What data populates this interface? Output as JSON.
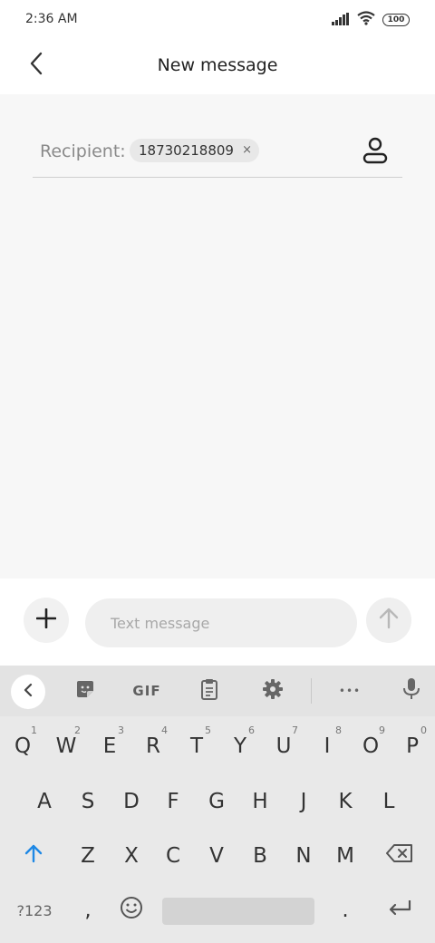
{
  "status": {
    "time": "2:36 AM",
    "battery": "100"
  },
  "header": {
    "title": "New message"
  },
  "recipient": {
    "label": "Recipient:",
    "number": "18730218809",
    "remove_symbol": "×"
  },
  "compose": {
    "placeholder": "Text message"
  },
  "keyboard": {
    "toolbar": {
      "gif_label": "GIF",
      "more_label": "•••"
    },
    "row1": [
      {
        "key": "Q",
        "hint": "1"
      },
      {
        "key": "W",
        "hint": "2"
      },
      {
        "key": "E",
        "hint": "3"
      },
      {
        "key": "R",
        "hint": "4"
      },
      {
        "key": "T",
        "hint": "5"
      },
      {
        "key": "Y",
        "hint": "6"
      },
      {
        "key": "U",
        "hint": "7"
      },
      {
        "key": "I",
        "hint": "8"
      },
      {
        "key": "O",
        "hint": "9"
      },
      {
        "key": "P",
        "hint": "0"
      }
    ],
    "row2": [
      "A",
      "S",
      "D",
      "F",
      "G",
      "H",
      "J",
      "K",
      "L"
    ],
    "row3": [
      "Z",
      "X",
      "C",
      "V",
      "B",
      "N",
      "M"
    ],
    "row4": {
      "symbols": "?123",
      "comma": ",",
      "period": "."
    }
  },
  "colors": {
    "shift_accent": "#1e88e5",
    "content_bg": "#f7f7f7",
    "keyboard_bg": "#e9e9e9"
  }
}
